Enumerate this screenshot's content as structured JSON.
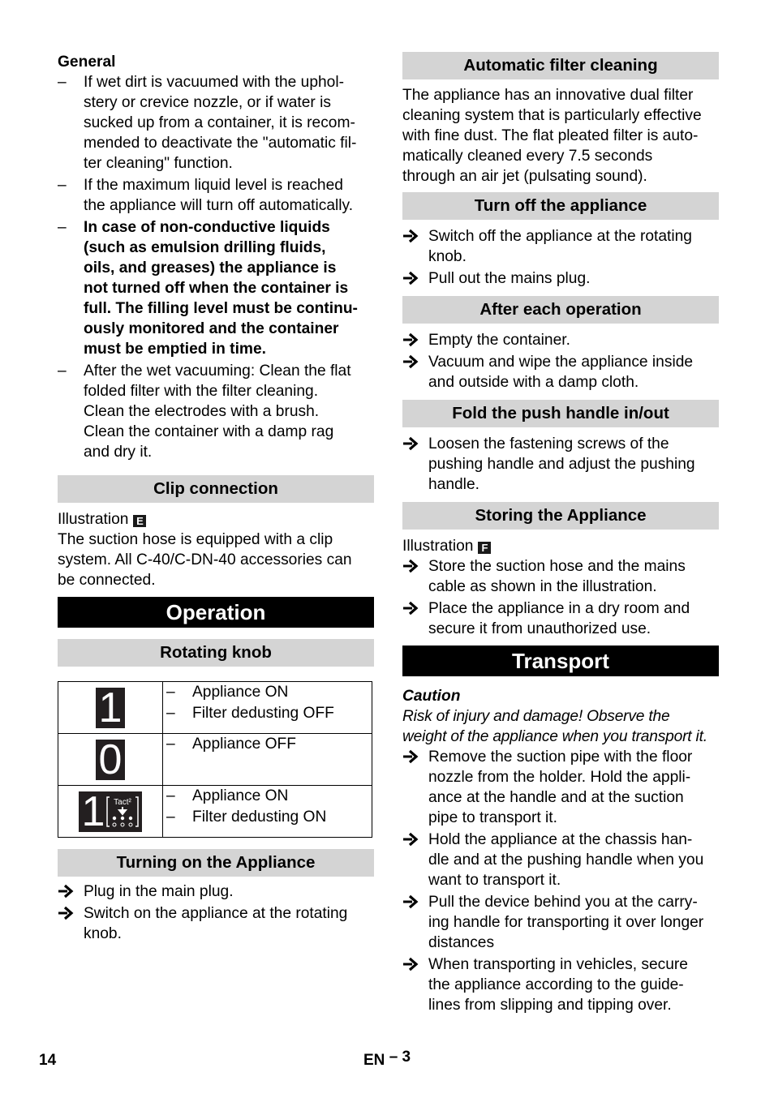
{
  "left": {
    "general": {
      "heading": "General",
      "items": [
        [
          "If wet dirt is vacuumed with the uphol-",
          "stery or crevice nozzle, or if water is",
          "sucked up from a container, it is recom-",
          "mended to deactivate the \"automatic fil-",
          "ter cleaning\" function."
        ],
        [
          "If the maximum liquid level is reached",
          "the appliance will turn off automatically."
        ],
        [
          "In case of non-conductive liquids",
          "(such as emulsion drilling fluids,",
          "oils, and greases) the appliance is",
          "not turned off when the container is",
          "full. The filling level must be continu-",
          "ously monitored and the container",
          "must be emptied in time."
        ],
        [
          "After the wet vacuuming: Clean the flat",
          "folded filter with the filter cleaning.",
          "Clean the electrodes with a brush.",
          "Clean the container with a damp rag",
          "and dry it."
        ]
      ]
    },
    "clip": {
      "heading": "Clip connection",
      "illustration_label": "Illustration",
      "illustration_ref": "E",
      "lines": [
        "The suction hose is equipped with a clip",
        "system.  All C-40/C-DN-40 accessories can",
        "be connected."
      ]
    },
    "operation": {
      "heading": "Operation"
    },
    "rotating_knob": {
      "heading": "Rotating knob",
      "rows": [
        {
          "symbol": "1",
          "items": [
            "Appliance ON",
            "Filter dedusting OFF"
          ]
        },
        {
          "symbol": "0",
          "items": [
            "Appliance OFF"
          ]
        },
        {
          "symbol": "1",
          "symbol_extra": "Tact²",
          "items": [
            "Appliance ON",
            "Filter dedusting ON"
          ]
        }
      ]
    },
    "turning_on": {
      "heading": "Turning on the Appliance",
      "items": [
        [
          "Plug in the main plug."
        ],
        [
          "Switch on the appliance at the rotating",
          "knob."
        ]
      ]
    }
  },
  "right": {
    "auto_filter": {
      "heading": "Automatic filter cleaning",
      "lines": [
        "The appliance has an innovative dual filter",
        "cleaning system that is particularly effective",
        "with fine dust. The flat pleated filter is auto-",
        "matically cleaned every 7.5 seconds",
        "through an air jet (pulsating sound)."
      ]
    },
    "turn_off": {
      "heading": "Turn off the appliance",
      "items": [
        [
          "Switch off the appliance at the rotating",
          "knob."
        ],
        [
          "Pull out the mains plug."
        ]
      ]
    },
    "after_op": {
      "heading": "After each operation",
      "items": [
        [
          "Empty the container."
        ],
        [
          "Vacuum and wipe the appliance inside",
          "and outside with a damp cloth."
        ]
      ]
    },
    "fold_handle": {
      "heading": "Fold the push handle in/out",
      "items": [
        [
          "Loosen the fastening screws of the",
          "pushing handle and adjust the pushing",
          "handle."
        ]
      ]
    },
    "storing": {
      "heading": "Storing the Appliance",
      "illustration_label": "Illustration",
      "illustration_ref": "F",
      "items": [
        [
          "Store the suction hose and the mains",
          "cable as shown in the illustration."
        ],
        [
          "Place the appliance in a dry room and",
          "secure it from unauthorized use."
        ]
      ]
    },
    "transport": {
      "heading": "Transport",
      "caution_label": "Caution",
      "caution_lines": [
        "Risk of injury and damage! Observe the",
        "weight of the appliance when you transport it."
      ],
      "items": [
        [
          "Remove the suction pipe with the floor",
          "nozzle from the holder. Hold the appli-",
          "ance at the handle and at the suction",
          "pipe to transport it."
        ],
        [
          "Hold the appliance at the chassis han-",
          "dle and at the pushing handle when you",
          "want to transport it."
        ],
        [
          "Pull the device behind you at the carry-",
          "ing handle for transporting it over longer",
          "distances"
        ],
        [
          "When transporting in vehicles, secure",
          "the appliance according to the guide-",
          "lines from slipping and tipping over."
        ]
      ]
    }
  },
  "footer": {
    "page_number": "14",
    "lang": "EN",
    "section": "– 3"
  }
}
